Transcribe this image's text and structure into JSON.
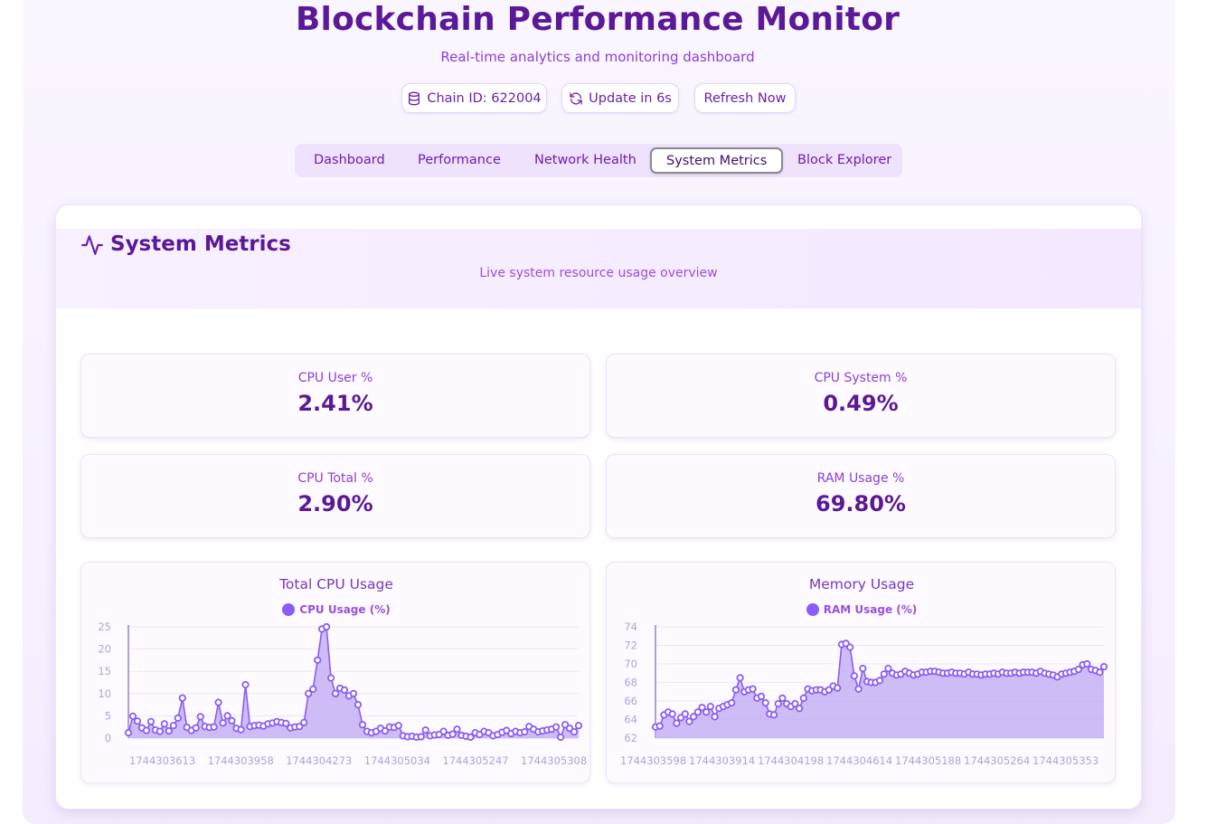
{
  "header": {
    "title": "Blockchain Performance Monitor",
    "subtitle": "Real-time analytics and monitoring dashboard",
    "chain_id": "Chain ID: 622004",
    "update": "Update in 6s",
    "refresh": "Refresh Now"
  },
  "tabs": [
    {
      "label": "Dashboard"
    },
    {
      "label": "Performance"
    },
    {
      "label": "Network Health"
    },
    {
      "label": "System Metrics",
      "active": true
    },
    {
      "label": "Block Explorer"
    }
  ],
  "section": {
    "title": "System Metrics",
    "subtitle": "Live system resource usage overview"
  },
  "metrics": [
    {
      "label": "CPU User %",
      "value": "2.41%"
    },
    {
      "label": "CPU System %",
      "value": "0.49%"
    },
    {
      "label": "CPU Total %",
      "value": "2.90%"
    },
    {
      "label": "RAM Usage %",
      "value": "69.80%"
    }
  ],
  "colors": {
    "accent": "#5b1897",
    "line": "#8b5cf6",
    "fill": "#c4b0f5"
  },
  "chart_data": [
    {
      "type": "area",
      "title": "Total CPU Usage",
      "series": [
        {
          "name": "CPU Usage (%)",
          "values": [
            1.2,
            4.9,
            3.8,
            2.3,
            1.7,
            3.7,
            1.8,
            1.5,
            3.2,
            1.6,
            2.8,
            4.5,
            9.0,
            2.4,
            1.7,
            2.3,
            4.8,
            2.6,
            2.4,
            2.5,
            8.0,
            3.4,
            5.0,
            3.9,
            2.2,
            1.9,
            12.0,
            2.6,
            2.8,
            2.9,
            2.7,
            3.2,
            3.4,
            3.7,
            3.5,
            3.3,
            2.3,
            2.5,
            2.6,
            3.5,
            10.0,
            11.0,
            17.5,
            24.5,
            25.0,
            13.5,
            10.0,
            11.2,
            10.8,
            9.5,
            10.0,
            7.5,
            3.0,
            1.5,
            1.2,
            1.5,
            2.2,
            1.6,
            2.5,
            2.4,
            2.8,
            0.5,
            0.3,
            0.4,
            0.2,
            0.3,
            1.8,
            0.5,
            0.7,
            0.8,
            1.5,
            0.6,
            0.9,
            2.0,
            0.6,
            0.4,
            0.2,
            1.2,
            0.8,
            1.5,
            1.2,
            0.5,
            0.8,
            1.3,
            1.7,
            1.0,
            1.5,
            1.2,
            1.4,
            2.6,
            2.0,
            1.4,
            1.6,
            1.8,
            2.0,
            2.5,
            0.2,
            3.0,
            2.2,
            1.4,
            2.8
          ]
        }
      ],
      "y_ticks": [
        0,
        5,
        10,
        15,
        20,
        25
      ],
      "ylim": [
        0,
        25
      ],
      "x_tick_labels": [
        "1744303613",
        "1744303958",
        "1744304273",
        "1744305034",
        "1744305247",
        "1744305308"
      ]
    },
    {
      "type": "area",
      "title": "Memory Usage",
      "series": [
        {
          "name": "RAM Usage (%)",
          "values": [
            63.2,
            63.3,
            64.5,
            64.8,
            64.6,
            63.6,
            64.2,
            64.6,
            63.8,
            64.3,
            64.8,
            65.3,
            64.8,
            65.4,
            64.3,
            65.2,
            65.4,
            65.6,
            65.8,
            67.2,
            68.5,
            67.0,
            67.2,
            67.3,
            66.3,
            66.5,
            65.8,
            64.6,
            64.5,
            65.7,
            66.3,
            65.7,
            65.4,
            65.7,
            65.2,
            66.3,
            67.3,
            67.1,
            67.2,
            67.2,
            67.0,
            67.2,
            67.6,
            67.4,
            72.1,
            72.2,
            71.8,
            68.7,
            67.3,
            69.5,
            68.1,
            68.0,
            68.0,
            68.2,
            68.9,
            69.5,
            69.0,
            68.8,
            68.9,
            69.2,
            69.0,
            68.8,
            68.9,
            69.1,
            69.1,
            69.2,
            69.2,
            69.1,
            69.0,
            69.0,
            69.1,
            69.0,
            69.0,
            68.9,
            69.1,
            68.9,
            68.9,
            68.8,
            68.9,
            68.9,
            69.0,
            68.9,
            69.1,
            69.0,
            69.0,
            69.1,
            69.0,
            69.1,
            69.1,
            69.1,
            69.0,
            69.2,
            69.0,
            68.9,
            68.8,
            68.6,
            68.9,
            69.0,
            69.1,
            69.2,
            69.4,
            69.9,
            70.0,
            69.4,
            69.3,
            69.1,
            69.7
          ]
        }
      ],
      "y_ticks": [
        62,
        64,
        66,
        68,
        70,
        72,
        74
      ],
      "ylim": [
        62,
        74
      ],
      "x_tick_labels": [
        "1744303598",
        "1744303914",
        "1744304198",
        "1744304614",
        "1744305188",
        "1744305264",
        "1744305353"
      ]
    }
  ]
}
